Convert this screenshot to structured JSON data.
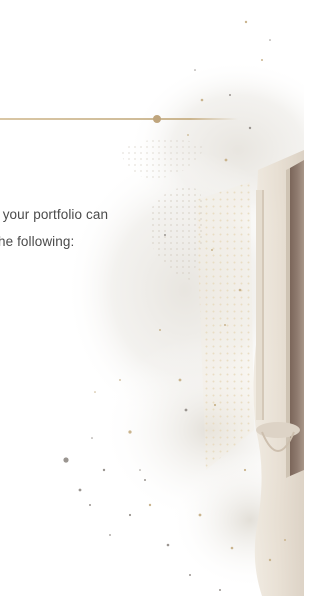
{
  "content": {
    "line_1": "f your portfolio can",
    "line_2": "he following:"
  },
  "colors": {
    "background": "#ffffff",
    "accent_gold": "#cbb58e",
    "text": "#4a4a4a"
  }
}
